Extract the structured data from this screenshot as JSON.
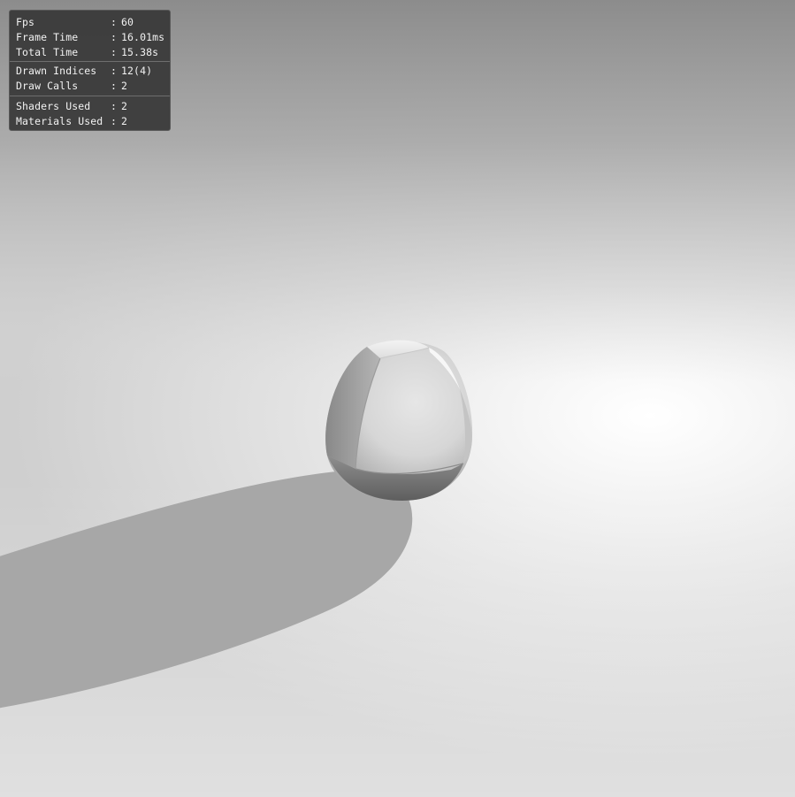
{
  "stats": {
    "groups": [
      [
        {
          "label": "Fps",
          "value": "60"
        },
        {
          "label": "Frame Time",
          "value": "16.01ms"
        },
        {
          "label": "Total Time",
          "value": "15.38s"
        }
      ],
      [
        {
          "label": "Drawn Indices",
          "value": "12(4)"
        },
        {
          "label": "Draw Calls",
          "value": "2"
        }
      ],
      [
        {
          "label": "Shaders Used",
          "value": "2"
        },
        {
          "label": "Materials Used",
          "value": "2"
        }
      ]
    ],
    "separator": ":"
  },
  "scene": {
    "objects": [
      "shaded-sphere",
      "ground-plane",
      "sphere-shadow"
    ],
    "colors": {
      "background_top": "#8f8f8f",
      "background_highlight": "#fdfdfd",
      "shadow": "#a6a6a6",
      "sphere_light": "#e2e2e2",
      "sphere_dark": "#6a6a6a"
    }
  }
}
